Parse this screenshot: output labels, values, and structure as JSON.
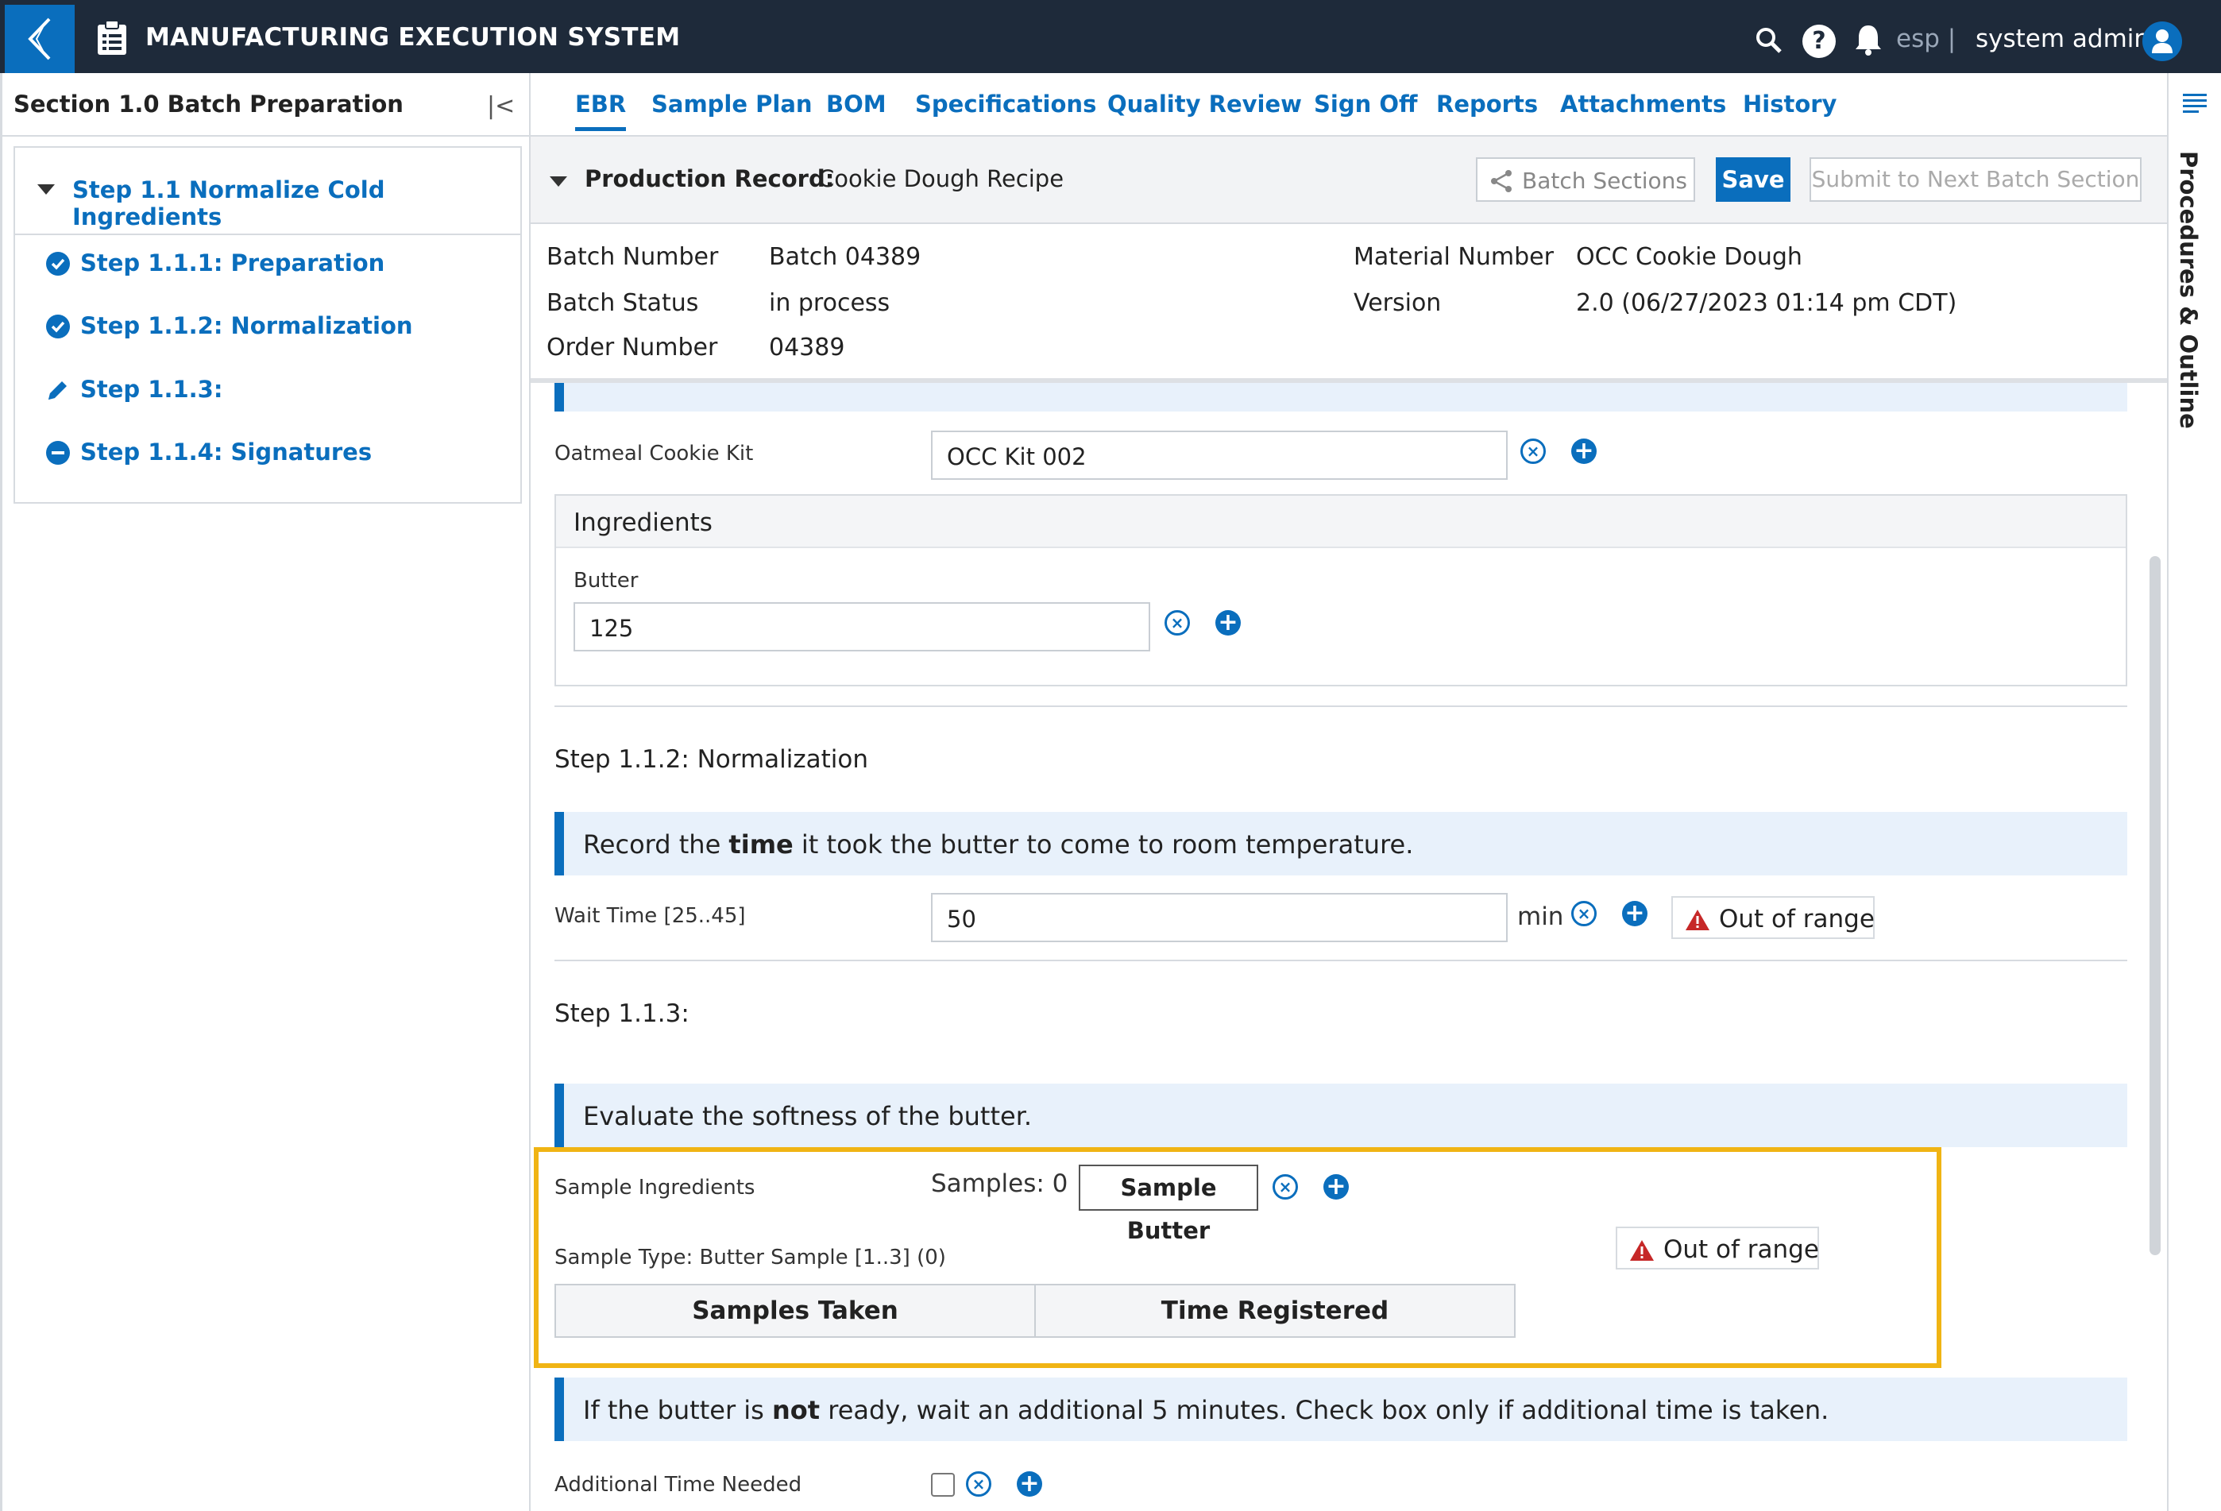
{
  "app": {
    "title": "MANUFACTURING EXECUTION SYSTEM",
    "lang": "esp |",
    "user": "system admin"
  },
  "sidebar": {
    "section_title": "Section 1.0 Batch Preparation",
    "step_group": "Step 1.1 Normalize Cold Ingredients",
    "items": [
      {
        "label": "Step 1.1.1: Preparation",
        "status": "complete"
      },
      {
        "label": "Step 1.1.2: Normalization",
        "status": "complete"
      },
      {
        "label": "Step 1.1.3:",
        "status": "editing"
      },
      {
        "label": "Step 1.1.4: Signatures",
        "status": "pending"
      }
    ]
  },
  "tabs": [
    "EBR",
    "Sample Plan",
    "BOM",
    "Specifications",
    "Quality Review",
    "Sign Off",
    "Reports",
    "Attachments",
    "History"
  ],
  "right_rail": {
    "label": "Procedures & Outline"
  },
  "record": {
    "label": "Production Record:",
    "value": "Cookie Dough Recipe",
    "batch_sections_label": "Batch Sections",
    "save_label": "Save",
    "submit_label": "Submit to Next Batch Section"
  },
  "batch": {
    "batch_number_label": "Batch Number",
    "batch_number": "Batch 04389",
    "batch_status_label": "Batch Status",
    "batch_status": "in process",
    "order_number_label": "Order Number",
    "order_number": "04389",
    "material_number_label": "Material Number",
    "material_number": "OCC Cookie Dough",
    "version_label": "Version",
    "version": "2.0 (06/27/2023 01:14 pm CDT)"
  },
  "form": {
    "kit_label": "Oatmeal Cookie Kit",
    "kit_value": "OCC Kit 002",
    "ingredients_header": "Ingredients",
    "butter_label": "Butter",
    "butter_value": "125",
    "step2_title": "Step 1.1.2: Normalization",
    "step2_instruction_pre": "Record the ",
    "step2_instruction_bold": "time",
    "step2_instruction_post": " it took the butter to come to room temperature.",
    "wait_label": "Wait Time [25..45]",
    "wait_value": "50",
    "wait_unit": "min",
    "out_of_range": "Out of range",
    "step3_title": "Step 1.1.3:",
    "step3_instruction": "Evaluate the softness of the butter.",
    "sample_ingredients_label": "Sample Ingredients",
    "samples_count": "Samples: 0",
    "sample_button": "Sample Butter",
    "sample_type": "Sample Type: Butter Sample [1..3] (0)",
    "table_headers": [
      "Samples Taken",
      "Time Registered"
    ],
    "step4_instruction_pre": "If the butter is ",
    "step4_instruction_bold": "not",
    "step4_instruction_post": " ready, wait an additional 5 minutes. Check box only if additional time is taken.",
    "additional_time_label": "Additional Time Needed"
  },
  "colors": {
    "topbar": "#1e2a3a",
    "accent": "#0a6ebd",
    "highlight": "#f0b414",
    "warning": "#c62828"
  }
}
